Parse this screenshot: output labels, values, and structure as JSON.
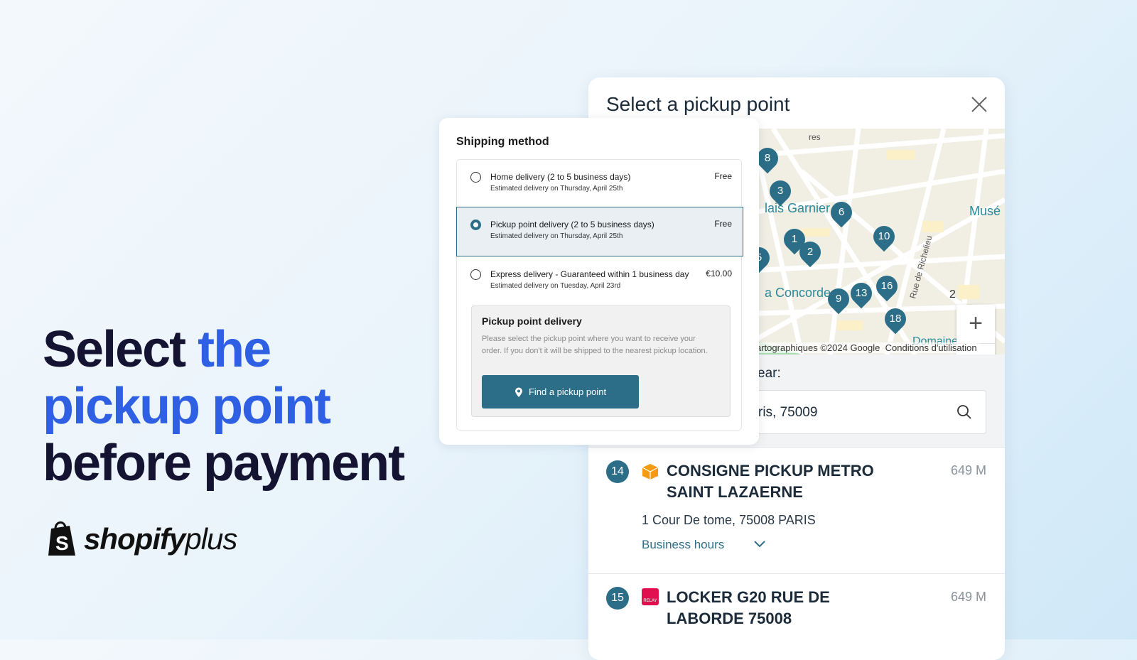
{
  "headline": {
    "line1_a": "Select ",
    "line1_b": "the",
    "line2": "pickup point",
    "line3": "before payment"
  },
  "logo": {
    "brand": "shopify",
    "suffix": "plus"
  },
  "modal": {
    "title": "Select a pickup point",
    "map": {
      "markers": [
        "8",
        "3",
        "6",
        "1",
        "2",
        "10",
        "9",
        "13",
        "16",
        "18",
        "5"
      ],
      "labels": {
        "garnier": "lais Garnier",
        "concorde": "a Concorde",
        "musee": "Musé",
        "domaine": "Domaine Natior",
        "richelieu": "Rue de Richelieu",
        "top": "res",
        "scale": "2"
      },
      "attribution": "artographiques ©2024 Google",
      "terms": "Conditions d'utilisation"
    },
    "search": {
      "label": "ear:",
      "value": "ris, 75009"
    },
    "items": [
      {
        "num": "14",
        "name": "CONSIGNE PICKUP METRO SAINT LAZAERNE",
        "distance": "649 M",
        "address": "1 Cour De tome, 75008 PARIS",
        "hours": "Business hours",
        "carrier_color": "#f39c12"
      },
      {
        "num": "15",
        "name": "LOCKER G20 RUE DE LABORDE 75008",
        "distance": "649 M",
        "carrier_label": "RELAY",
        "carrier_color": "#e0104f"
      }
    ]
  },
  "shipping": {
    "title": "Shipping method",
    "options": [
      {
        "title": "Home delivery (2 to 5 business days)",
        "sub": "Estimated delivery on Thursday, April 25th",
        "price": "Free",
        "selected": false
      },
      {
        "title": "Pickup point delivery (2 to 5 business days)",
        "sub": "Estimated delivery on Thursday, April 25th",
        "price": "Free",
        "selected": true
      },
      {
        "title": "Express delivery - Guaranteed within 1 business day",
        "sub": "Estimated delivery on Tuesday, April 23rd",
        "price": "€10.00",
        "selected": false
      }
    ],
    "pickup_box": {
      "title": "Pickup point delivery",
      "text": "Please select the pickup point where you want to receive your order. If you don't it will be shipped to the nearest pickup location.",
      "button": "Find a pickup point"
    }
  },
  "colors": {
    "accent": "#2c6e88",
    "headline_blue": "#2f5fe3"
  }
}
